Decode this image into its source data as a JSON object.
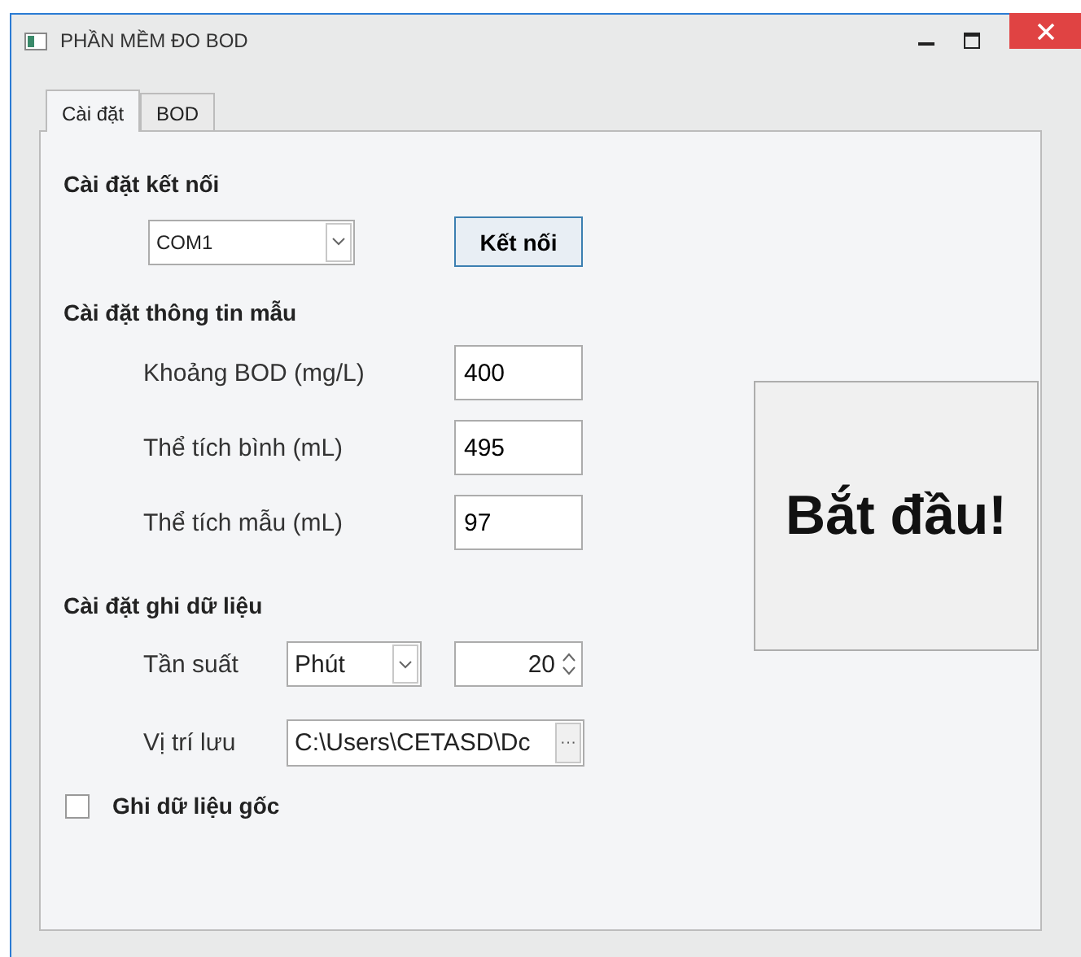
{
  "window": {
    "title": "PHẦN MỀM ĐO BOD"
  },
  "tabs": [
    {
      "label": "Cài đặt",
      "selected": true
    },
    {
      "label": "BOD",
      "selected": false
    }
  ],
  "connection": {
    "heading": "Cài đặt kết nối",
    "port": "COM1",
    "connect_button": "Kết nối"
  },
  "sample": {
    "heading": "Cài đặt thông tin mẫu",
    "fields": [
      {
        "label": "Khoảng BOD (mg/L)",
        "value": "400"
      },
      {
        "label": "Thể tích bình (mL)",
        "value": "495"
      },
      {
        "label": "Thể tích mẫu (mL)",
        "value": "97"
      }
    ]
  },
  "logging": {
    "heading": "Cài đặt ghi dữ liệu",
    "frequency_label": "Tần suất",
    "frequency_unit": "Phút",
    "frequency_value": "20",
    "path_label": "Vị trí lưu",
    "path": "C:\\Users\\CETASD\\Dc",
    "browse_button": "···"
  },
  "raw_data": {
    "label": "Ghi dữ liệu gốc",
    "checked": false
  },
  "start_button": "Bắt đầu!"
}
